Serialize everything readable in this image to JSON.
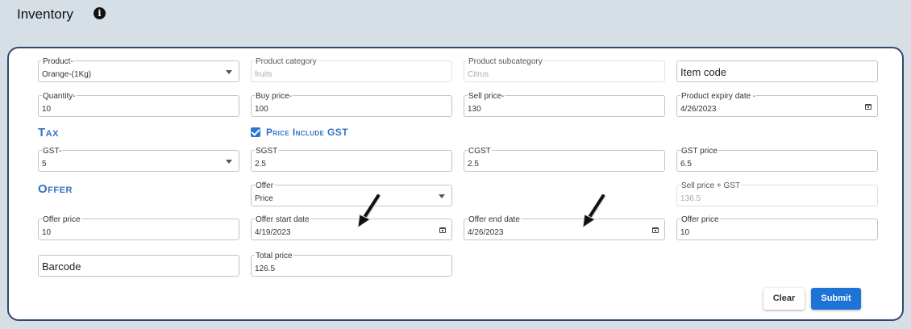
{
  "header": {
    "title": "Inventory",
    "info_icon": "info-circle-icon"
  },
  "product": {
    "product_label": "Product-",
    "product_value": "Orange-(1Kg)",
    "category_label": "Product category",
    "category_value": "fruits",
    "subcategory_label": "Product subcategory",
    "subcategory_value": "Citrus",
    "item_code_placeholder": "Item code",
    "quantity_label": "Quantity-",
    "quantity_value": "10",
    "buy_price_label": "Buy price-",
    "buy_price_value": "100",
    "sell_price_label": "Sell price-",
    "sell_price_value": "130",
    "expiry_label": "Product expiry date -",
    "expiry_value": "4/26/2023"
  },
  "tax": {
    "section_title": "Tax",
    "checkbox_label": "Price Include GST",
    "checkbox_checked": true,
    "gst_label": "GST-",
    "gst_value": "5",
    "sgst_label": "SGST",
    "sgst_value": "2.5",
    "cgst_label": "CGST",
    "cgst_value": "2.5",
    "gst_price_label": "GST price",
    "gst_price_value": "6.5"
  },
  "offer": {
    "section_title": "Offer",
    "offer_label": "Offer",
    "offer_value": "Price",
    "sell_gst_label": "Sell price + GST",
    "sell_gst_value": "136.5",
    "offer_price_label": "Offer price",
    "offer_price_value": "10",
    "start_label": "Offer start date",
    "start_value": "4/19/2023",
    "end_label": "Offer end date",
    "end_value": "4/26/2023",
    "offer_price2_label": "Offer price",
    "offer_price2_value": "10",
    "barcode_placeholder": "Barcode",
    "total_label": "Total price",
    "total_value": "126.5"
  },
  "actions": {
    "clear_label": "Clear",
    "submit_label": "Submit",
    "submit_color": "#1e73d6"
  }
}
